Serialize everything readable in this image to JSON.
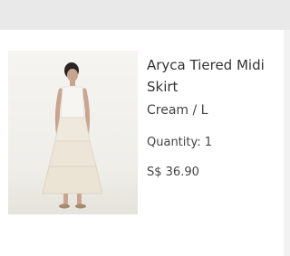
{
  "product": {
    "name": "Aryca Tiered Midi Skirt",
    "variant": "Cream / L",
    "quantity_label": "Quantity: 1",
    "price": "S$ 36.90",
    "image_icon": "model-wearing-cream-skirt"
  },
  "colors": {
    "background": "#e9e9e9",
    "card": "#ffffff",
    "text": "#333333"
  }
}
